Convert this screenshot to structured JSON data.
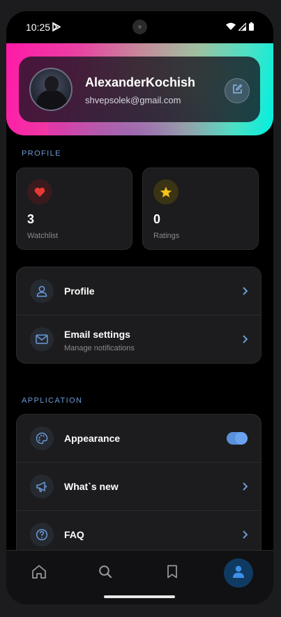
{
  "status_bar": {
    "time": "10:25"
  },
  "profile_header": {
    "name": "AlexanderKochish",
    "email": "shvepsolek@gmail.com"
  },
  "sections": {
    "profile": "PROFILE",
    "application": "APPLICATION"
  },
  "stats": [
    {
      "value": "3",
      "label": "Watchlist",
      "icon": "heart-icon",
      "color": "#e53935"
    },
    {
      "value": "0",
      "label": "Ratings",
      "icon": "star-icon",
      "color": "#f5c518"
    }
  ],
  "profile_menu": [
    {
      "title": "Profile",
      "icon": "person-icon"
    },
    {
      "title": "Email settings",
      "subtitle": "Manage notifications",
      "icon": "mail-icon"
    }
  ],
  "app_menu": [
    {
      "title": "Appearance",
      "icon": "palette-icon",
      "toggle_on": true
    },
    {
      "title": "What`s new",
      "icon": "megaphone-icon"
    },
    {
      "title": "FAQ",
      "icon": "question-icon"
    }
  ],
  "bottom_nav": [
    {
      "name": "home",
      "icon": "home-icon"
    },
    {
      "name": "search",
      "icon": "search-icon"
    },
    {
      "name": "bookmarks",
      "icon": "bookmark-icon"
    },
    {
      "name": "account",
      "icon": "person-icon",
      "active": true
    }
  ],
  "colors": {
    "accent": "#6b9bd8",
    "active_nav": "#0f3b63"
  }
}
